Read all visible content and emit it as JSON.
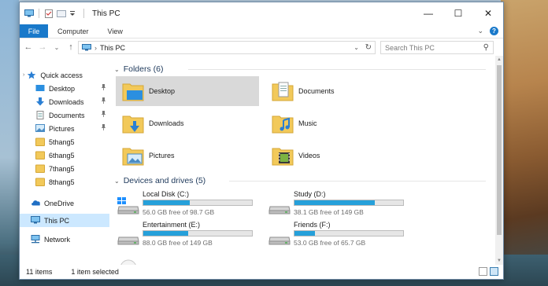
{
  "titlebar": {
    "title": "This PC",
    "minimize": "—",
    "maximize": "☐",
    "close": "✕"
  },
  "ribbon": {
    "file": "File",
    "tabs": [
      "Computer",
      "View"
    ],
    "expand_glyph": "⌄",
    "help": "?"
  },
  "navbar": {
    "back": "←",
    "forward": "→",
    "recent": "⌄",
    "up": "↑",
    "separator": "›",
    "path": "This PC",
    "dropdown": "⌄",
    "refresh": "↻"
  },
  "search": {
    "placeholder": "Search This PC",
    "icon": "⚲"
  },
  "sidebar": {
    "quick_access": "Quick access",
    "pinned": [
      {
        "label": "Desktop",
        "icon": "desktop-icon"
      },
      {
        "label": "Downloads",
        "icon": "downloads-icon"
      },
      {
        "label": "Documents",
        "icon": "documents-icon"
      },
      {
        "label": "Pictures",
        "icon": "pictures-icon"
      }
    ],
    "folders": [
      "5thang5",
      "6thang5",
      "7thang5",
      "8thang5"
    ],
    "onedrive": "OneDrive",
    "this_pc": "This PC",
    "network": "Network",
    "pin_glyph": "📌"
  },
  "content": {
    "folders_header": "Folders (6)",
    "folders": [
      {
        "label": "Desktop",
        "icon": "desktop-folder-icon"
      },
      {
        "label": "Documents",
        "icon": "documents-folder-icon"
      },
      {
        "label": "Downloads",
        "icon": "downloads-folder-icon"
      },
      {
        "label": "Music",
        "icon": "music-folder-icon"
      },
      {
        "label": "Pictures",
        "icon": "pictures-folder-icon"
      },
      {
        "label": "Videos",
        "icon": "videos-folder-icon"
      }
    ],
    "drives_header": "Devices and drives (5)",
    "drives": [
      {
        "name": "Local Disk (C:)",
        "free": "56.0 GB free of 98.7 GB",
        "used_fraction": 0.43
      },
      {
        "name": "Study (D:)",
        "free": "38.1 GB free of 149 GB",
        "used_fraction": 0.74
      },
      {
        "name": "Entertainment (E:)",
        "free": "88.0 GB free of 149 GB",
        "used_fraction": 0.41
      },
      {
        "name": "Friends (F:)",
        "free": "53.0 GB free of 65.7 GB",
        "used_fraction": 0.19
      }
    ],
    "chevron": "⌄"
  },
  "status": {
    "count": "11 items",
    "selected": "1 item selected"
  },
  "colors": {
    "accent": "#1979ca",
    "drive_fill": "#26a0da",
    "selection": "#cce8ff",
    "folder_yellow": "#f2c95a"
  }
}
